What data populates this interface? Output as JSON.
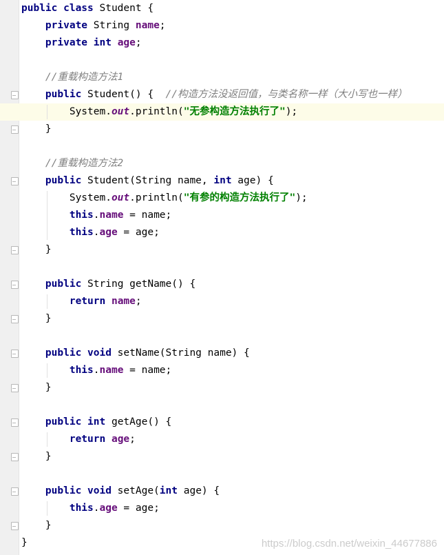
{
  "editor": {
    "lines": [
      {
        "tokens": [
          {
            "t": "kw",
            "v": "public class"
          },
          {
            "t": "plain",
            "v": " Student {"
          }
        ]
      },
      {
        "tokens": [
          {
            "t": "plain",
            "v": "    "
          },
          {
            "t": "kw",
            "v": "private"
          },
          {
            "t": "plain",
            "v": " String "
          },
          {
            "t": "field",
            "v": "name"
          },
          {
            "t": "plain",
            "v": ";"
          }
        ]
      },
      {
        "tokens": [
          {
            "t": "plain",
            "v": "    "
          },
          {
            "t": "kw",
            "v": "private int"
          },
          {
            "t": "plain",
            "v": " "
          },
          {
            "t": "field",
            "v": "age"
          },
          {
            "t": "plain",
            "v": ";"
          }
        ]
      },
      {
        "tokens": []
      },
      {
        "tokens": [
          {
            "t": "plain",
            "v": "    "
          },
          {
            "t": "cmt",
            "v": "//重载构造方法1"
          }
        ]
      },
      {
        "tokens": [
          {
            "t": "plain",
            "v": "    "
          },
          {
            "t": "kw",
            "v": "public"
          },
          {
            "t": "plain",
            "v": " Student() {  "
          },
          {
            "t": "cmt",
            "v": "//构造方法没返回值，与类名称一样（大小写也一样）"
          }
        ]
      },
      {
        "tokens": [
          {
            "t": "plain",
            "v": "        System."
          },
          {
            "t": "static",
            "v": "out"
          },
          {
            "t": "plain",
            "v": ".println("
          },
          {
            "t": "str",
            "v": "\"无参构造方法执行了\""
          },
          {
            "t": "plain",
            "v": ");"
          }
        ],
        "highlight": true
      },
      {
        "tokens": [
          {
            "t": "plain",
            "v": "    }"
          }
        ]
      },
      {
        "tokens": []
      },
      {
        "tokens": [
          {
            "t": "plain",
            "v": "    "
          },
          {
            "t": "cmt",
            "v": "//重载构造方法2"
          }
        ]
      },
      {
        "tokens": [
          {
            "t": "plain",
            "v": "    "
          },
          {
            "t": "kw",
            "v": "public"
          },
          {
            "t": "plain",
            "v": " Student(String name, "
          },
          {
            "t": "kw",
            "v": "int"
          },
          {
            "t": "plain",
            "v": " age) {"
          }
        ]
      },
      {
        "tokens": [
          {
            "t": "plain",
            "v": "        System."
          },
          {
            "t": "static",
            "v": "out"
          },
          {
            "t": "plain",
            "v": ".println("
          },
          {
            "t": "str",
            "v": "\"有参的构造方法执行了\""
          },
          {
            "t": "plain",
            "v": ");"
          }
        ]
      },
      {
        "tokens": [
          {
            "t": "plain",
            "v": "        "
          },
          {
            "t": "kw",
            "v": "this"
          },
          {
            "t": "plain",
            "v": "."
          },
          {
            "t": "field",
            "v": "name"
          },
          {
            "t": "plain",
            "v": " = name;"
          }
        ]
      },
      {
        "tokens": [
          {
            "t": "plain",
            "v": "        "
          },
          {
            "t": "kw",
            "v": "this"
          },
          {
            "t": "plain",
            "v": "."
          },
          {
            "t": "field",
            "v": "age"
          },
          {
            "t": "plain",
            "v": " = age;"
          }
        ]
      },
      {
        "tokens": [
          {
            "t": "plain",
            "v": "    }"
          }
        ]
      },
      {
        "tokens": []
      },
      {
        "tokens": [
          {
            "t": "plain",
            "v": "    "
          },
          {
            "t": "kw",
            "v": "public"
          },
          {
            "t": "plain",
            "v": " String getName() {"
          }
        ]
      },
      {
        "tokens": [
          {
            "t": "plain",
            "v": "        "
          },
          {
            "t": "kw",
            "v": "return"
          },
          {
            "t": "plain",
            "v": " "
          },
          {
            "t": "field",
            "v": "name"
          },
          {
            "t": "plain",
            "v": ";"
          }
        ]
      },
      {
        "tokens": [
          {
            "t": "plain",
            "v": "    }"
          }
        ]
      },
      {
        "tokens": []
      },
      {
        "tokens": [
          {
            "t": "plain",
            "v": "    "
          },
          {
            "t": "kw",
            "v": "public void"
          },
          {
            "t": "plain",
            "v": " setName(String name) {"
          }
        ]
      },
      {
        "tokens": [
          {
            "t": "plain",
            "v": "        "
          },
          {
            "t": "kw",
            "v": "this"
          },
          {
            "t": "plain",
            "v": "."
          },
          {
            "t": "field",
            "v": "name"
          },
          {
            "t": "plain",
            "v": " = name;"
          }
        ]
      },
      {
        "tokens": [
          {
            "t": "plain",
            "v": "    }"
          }
        ]
      },
      {
        "tokens": []
      },
      {
        "tokens": [
          {
            "t": "plain",
            "v": "    "
          },
          {
            "t": "kw",
            "v": "public int"
          },
          {
            "t": "plain",
            "v": " getAge() {"
          }
        ]
      },
      {
        "tokens": [
          {
            "t": "plain",
            "v": "        "
          },
          {
            "t": "kw",
            "v": "return"
          },
          {
            "t": "plain",
            "v": " "
          },
          {
            "t": "field",
            "v": "age"
          },
          {
            "t": "plain",
            "v": ";"
          }
        ]
      },
      {
        "tokens": [
          {
            "t": "plain",
            "v": "    }"
          }
        ]
      },
      {
        "tokens": []
      },
      {
        "tokens": [
          {
            "t": "plain",
            "v": "    "
          },
          {
            "t": "kw",
            "v": "public void"
          },
          {
            "t": "plain",
            "v": " setAge("
          },
          {
            "t": "kw",
            "v": "int"
          },
          {
            "t": "plain",
            "v": " age) {"
          }
        ]
      },
      {
        "tokens": [
          {
            "t": "plain",
            "v": "        "
          },
          {
            "t": "kw",
            "v": "this"
          },
          {
            "t": "plain",
            "v": "."
          },
          {
            "t": "field",
            "v": "age"
          },
          {
            "t": "plain",
            "v": " = age;"
          }
        ]
      },
      {
        "tokens": [
          {
            "t": "plain",
            "v": "    }"
          }
        ]
      },
      {
        "tokens": [
          {
            "t": "plain",
            "v": "}"
          }
        ]
      }
    ]
  },
  "watermark": "https://blog.csdn.net/weixin_44677886",
  "colors": {
    "keyword": "#000080",
    "field": "#660e7a",
    "string": "#008000",
    "comment": "#808080",
    "current_line": "#fdfce8"
  }
}
